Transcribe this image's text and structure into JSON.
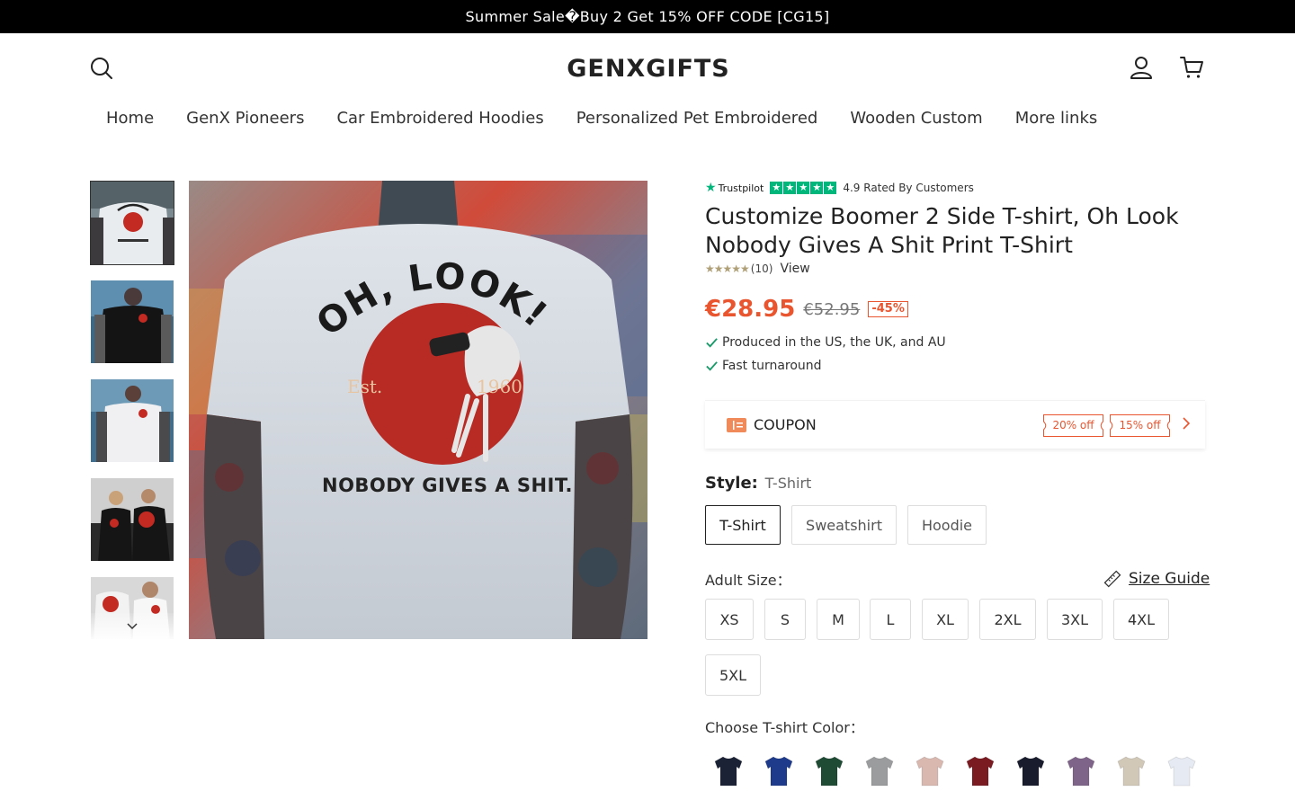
{
  "announcement": "Summer Sale�Buy 2 Get 15% OFF CODE [CG15]",
  "logo": "GENXGIFTS",
  "nav": [
    "Home",
    "GenX Pioneers",
    "Car Embroidered Hoodies",
    "Personalized Pet Embroidered",
    "Wooden Custom",
    "More links"
  ],
  "header_icons": [
    "search-icon",
    "account-icon",
    "cart-icon"
  ],
  "trustpilot": {
    "brand": "Trustpilot",
    "rating_text": "4.9 Rated By Customers"
  },
  "product": {
    "title": "Customize Boomer 2 Side T-shirt, Oh Look Nobody Gives A Shit Print T-Shirt",
    "review_count": "(10)",
    "view_label": "View",
    "price": "€28.95",
    "compare_price": "€52.95",
    "discount": "-45%",
    "features": [
      "Produced in the US, the UK, and AU",
      "Fast turnaround"
    ],
    "image_text": {
      "arc": "OH, LOOK!",
      "est": "Est.",
      "year": "1960",
      "tagline": "NOBODY GIVES A SHIT."
    }
  },
  "coupon": {
    "label": "COUPON",
    "offers": [
      "20% off",
      "15% off"
    ],
    "accent": "#e8552f"
  },
  "style": {
    "label": "Style:",
    "selected": "T-Shirt",
    "options": [
      "T-Shirt",
      "Sweatshirt",
      "Hoodie"
    ]
  },
  "size": {
    "label": "Adult Size：",
    "guide": "Size Guide",
    "options": [
      "XS",
      "S",
      "M",
      "L",
      "XL",
      "2XL",
      "3XL",
      "4XL",
      "5XL"
    ]
  },
  "color": {
    "label": "Choose T-shirt Color：",
    "swatches": [
      "#1c2236",
      "#1e3a8a",
      "#1f4a34",
      "#9a9c9e",
      "#d9b8b0",
      "#7a1b22",
      "#181c2c",
      "#7e6488",
      "#d2c8b8",
      "#e6eaf2"
    ]
  },
  "price_color": "#e8552f",
  "trustpilot_green": "#00b67a"
}
